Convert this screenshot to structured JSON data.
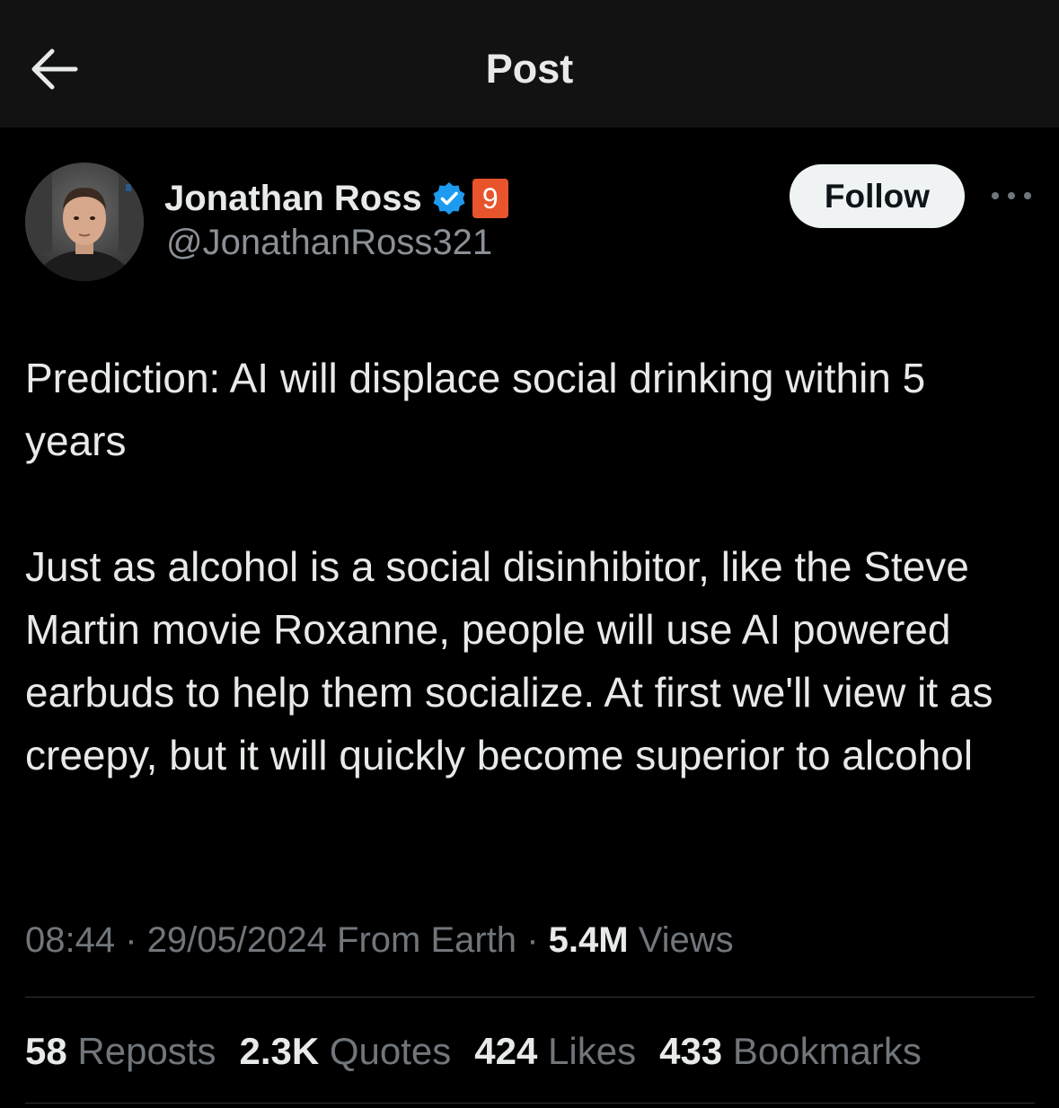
{
  "header": {
    "title": "Post",
    "back_icon": "arrow-left-icon"
  },
  "author": {
    "name": "Jonathan Ross",
    "handle": "@JonathanRoss321",
    "verified_color": "#1d9bf0",
    "affiliate_badge": "9",
    "affiliate_color": "#e8542c"
  },
  "actions": {
    "follow_label": "Follow",
    "more_icon": "more-horizontal-icon"
  },
  "post": {
    "paragraphs": [
      "Prediction: AI will displace social drinking within 5 years",
      "Just as alcohol is a social disinhibitor, like the Steve Martin movie Roxanne, people will use AI powered earbuds to help them socialize. At first we'll view it as creepy, but it will quickly become superior to alcohol"
    ]
  },
  "meta": {
    "time": "08:44",
    "separator": "·",
    "date": "29/05/2024",
    "source": "From Earth",
    "views_count": "5.4M",
    "views_label": "Views"
  },
  "stats": [
    {
      "count": "58",
      "label": "Reposts"
    },
    {
      "count": "2.3K",
      "label": "Quotes"
    },
    {
      "count": "424",
      "label": "Likes"
    },
    {
      "count": "433",
      "label": "Bookmarks"
    }
  ],
  "colors": {
    "background": "#000000",
    "header_bg": "#121212",
    "text_primary": "#e7e9ea",
    "text_secondary": "#71767b",
    "follow_bg": "#eff3f4"
  }
}
